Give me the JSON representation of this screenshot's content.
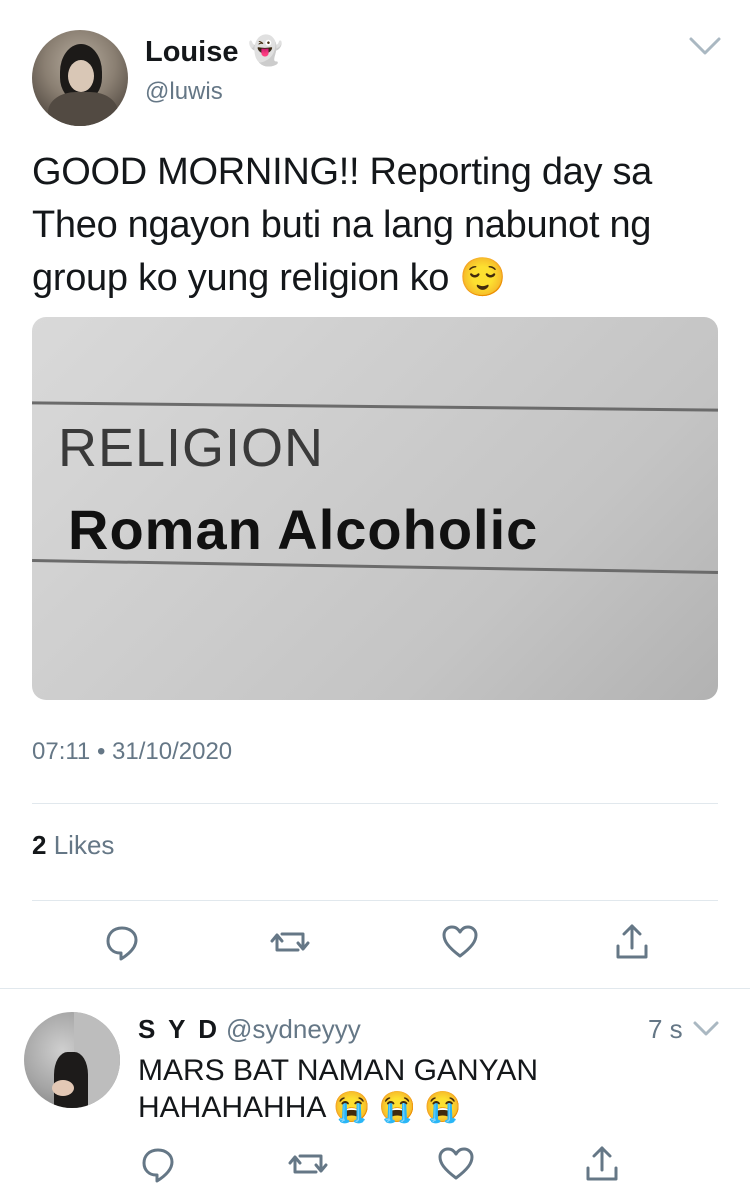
{
  "tweet": {
    "author_name": "Louise",
    "author_emoji": "👻",
    "author_handle": "@luwis",
    "text": "GOOD MORNING!! Reporting day sa Theo ngayon buti na lang nabunot ng group ko yung religion ko 😌",
    "media_text": {
      "label": "RELIGION",
      "value": "Roman Alcoholic"
    },
    "timestamp": "07:11 • 31/10/2020",
    "likes_count": "2",
    "likes_label": "Likes"
  },
  "reply": {
    "author_name": "S Y D",
    "author_handle": "@sydneyyy",
    "time": "7 s",
    "text": "MARS BAT NAMAN GANYAN HAHAHAHHA 😭 😭 😭"
  },
  "icons": {
    "reply": "reply-icon",
    "retweet": "retweet-icon",
    "like": "heart-icon",
    "share": "share-icon",
    "more": "chevron-down-icon"
  },
  "colors": {
    "icon": "#657786",
    "muted_text": "#657786",
    "divider": "#e1e8ed"
  }
}
